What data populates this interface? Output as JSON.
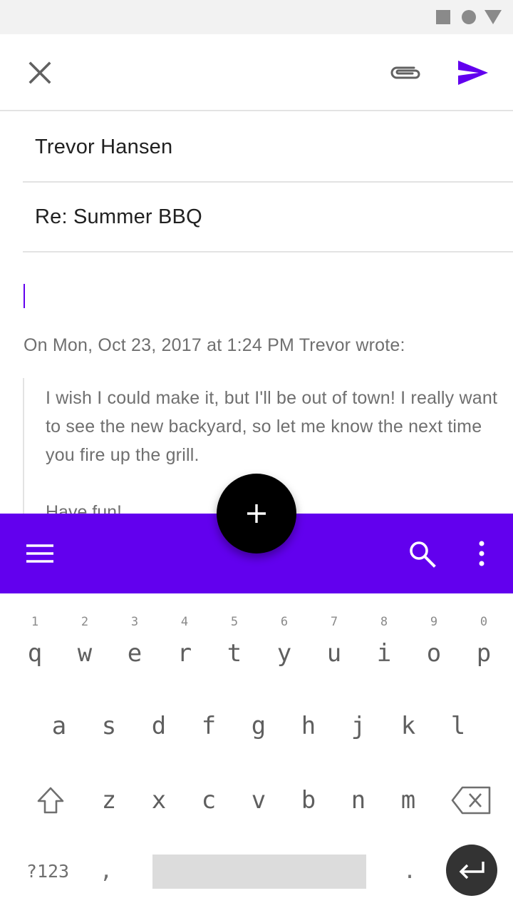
{
  "compose": {
    "to": "Trevor Hansen",
    "subject": "Re: Summer BBQ",
    "quote_header": "On Mon, Oct 23, 2017 at 1:24 PM Trevor wrote:",
    "quote_body": "I wish I could make it, but I'll be out of town! I really want to see the new backyard, so let me know the next time you fire up the grill.",
    "quote_sign": "Have fun!"
  },
  "icons": {
    "close": "close-icon",
    "attach": "paperclip-icon",
    "send": "send-icon",
    "menu": "menu-icon",
    "search": "search-icon",
    "more": "more-vert-icon",
    "fab": "plus-icon"
  },
  "colors": {
    "accent": "#6200ee",
    "fab": "#000000",
    "status_bar": "#f2f2f2"
  },
  "keyboard": {
    "row1": [
      {
        "hint": "1",
        "char": "q"
      },
      {
        "hint": "2",
        "char": "w"
      },
      {
        "hint": "3",
        "char": "e"
      },
      {
        "hint": "4",
        "char": "r"
      },
      {
        "hint": "5",
        "char": "t"
      },
      {
        "hint": "6",
        "char": "y"
      },
      {
        "hint": "7",
        "char": "u"
      },
      {
        "hint": "8",
        "char": "i"
      },
      {
        "hint": "9",
        "char": "o"
      },
      {
        "hint": "0",
        "char": "p"
      }
    ],
    "row2": [
      "a",
      "s",
      "d",
      "f",
      "g",
      "h",
      "j",
      "k",
      "l"
    ],
    "row3": [
      "z",
      "x",
      "c",
      "v",
      "b",
      "n",
      "m"
    ],
    "symbols": "?123",
    "comma": ",",
    "period": "."
  }
}
